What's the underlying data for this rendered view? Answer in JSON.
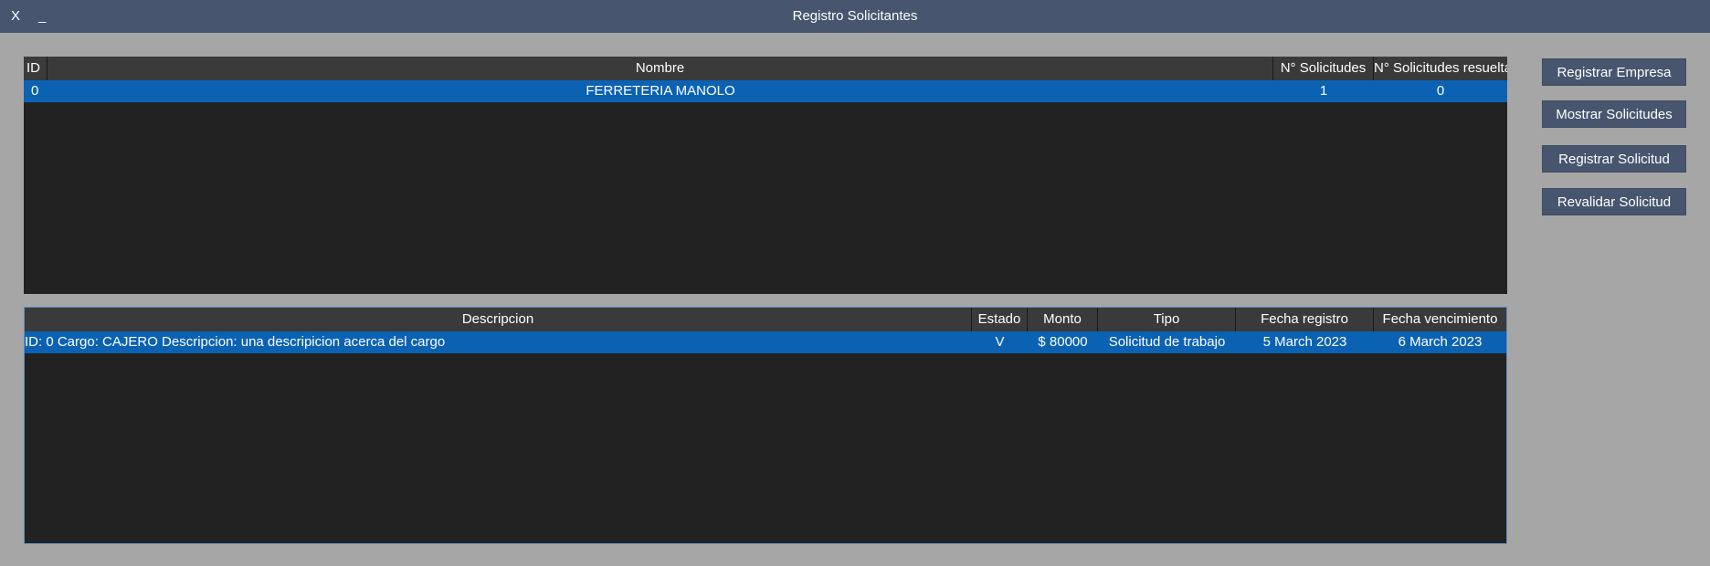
{
  "window": {
    "title": "Registro Solicitantes",
    "close_label": "X",
    "minimize_label": "_"
  },
  "companies_table": {
    "columns": [
      "ID",
      "Nombre",
      "N° Solicitudes",
      "N° Solicitudes resueltas"
    ],
    "rows": [
      {
        "id": "0",
        "nombre": "FERRETERIA MANOLO",
        "solicitudes": "1",
        "resueltas": "0"
      }
    ]
  },
  "requests_table": {
    "columns": [
      "Descripcion",
      "Estado",
      "Monto",
      "Tipo",
      "Fecha registro",
      "Fecha vencimiento"
    ],
    "rows": [
      {
        "descripcion": "ID: 0 Cargo: CAJERO Descripcion: una descripicion acerca del cargo",
        "estado": "V",
        "monto": "$ 80000",
        "tipo": "Solicitud de trabajo",
        "fecha_registro": "5 March 2023",
        "fecha_vencimiento": "6 March 2023"
      }
    ]
  },
  "actions": {
    "registrar_empresa": "Registrar Empresa",
    "mostrar_solicitudes": "Mostrar Solicitudes",
    "registrar_solicitud": "Registrar Solicitud",
    "revalidar_solicitud": "Revalidar Solicitud"
  },
  "colors": {
    "background": "#a6a6a6",
    "titlebar": "#47566e",
    "table_background": "#222222",
    "table_header": "#3a3a3a",
    "selected_row": "#0b62b3",
    "button": "#47566e"
  }
}
